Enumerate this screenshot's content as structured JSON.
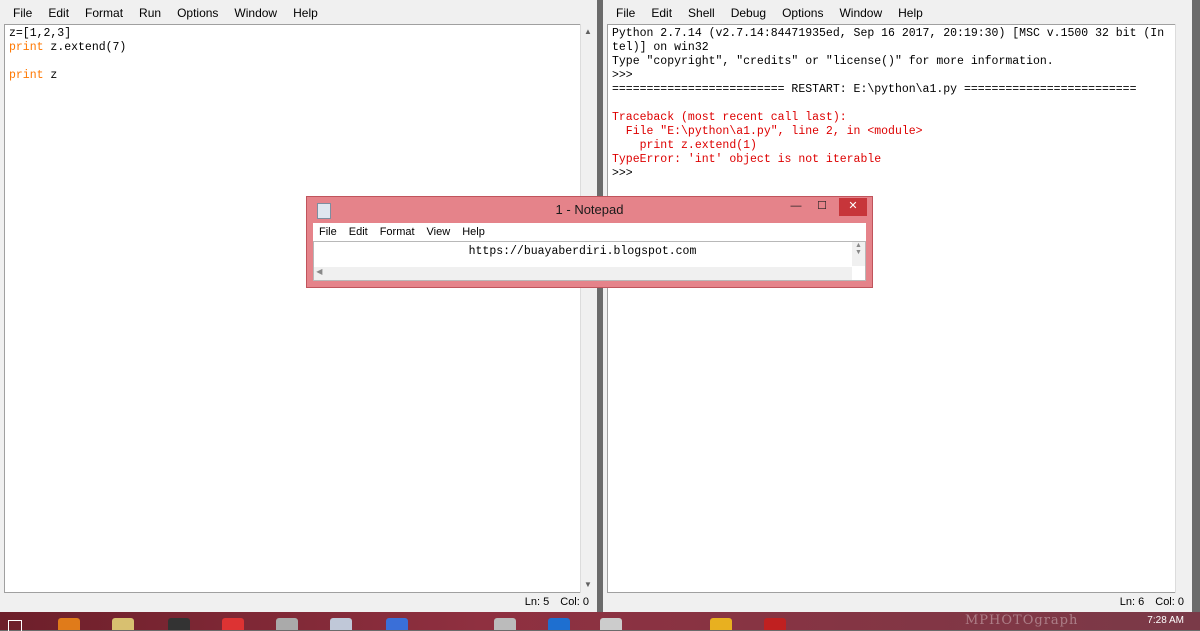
{
  "editor_window": {
    "menu": [
      "File",
      "Edit",
      "Format",
      "Run",
      "Options",
      "Window",
      "Help"
    ],
    "code": [
      [
        {
          "t": "z=[1,2,3]",
          "c": "plain"
        }
      ],
      [
        {
          "t": "print",
          "c": "kw"
        },
        {
          "t": " z.extend(7)",
          "c": "plain"
        }
      ],
      [
        {
          "t": "",
          "c": "plain"
        }
      ],
      [
        {
          "t": "print",
          "c": "kw"
        },
        {
          "t": " z",
          "c": "plain"
        }
      ]
    ],
    "status": {
      "ln": "Ln: 5",
      "col": "Col: 0"
    }
  },
  "shell_window": {
    "menu": [
      "File",
      "Edit",
      "Shell",
      "Debug",
      "Options",
      "Window",
      "Help"
    ],
    "lines": [
      {
        "t": "Python 2.7.14 (v2.7.14:84471935ed, Sep 16 2017, 20:19:30) [MSC v.1500 32 bit (In",
        "c": "plain"
      },
      {
        "t": "tel)] on win32",
        "c": "plain"
      },
      {
        "t": "Type \"copyright\", \"credits\" or \"license()\" for more information.",
        "c": "plain"
      },
      {
        "t": ">>> ",
        "c": "plain"
      },
      {
        "t": "========================= RESTART: E:\\python\\a1.py =========================",
        "c": "plain"
      },
      {
        "t": "",
        "c": "plain"
      },
      {
        "t": "Traceback (most recent call last):",
        "c": "red"
      },
      {
        "t": "  File \"E:\\python\\a1.py\", line 2, in <module>",
        "c": "red"
      },
      {
        "t": "    print z.extend(1)",
        "c": "red"
      },
      {
        "t": "TypeError: 'int' object is not iterable",
        "c": "red"
      },
      {
        "t": ">>> ",
        "c": "plain"
      }
    ],
    "status": {
      "ln": "Ln: 6",
      "col": "Col: 0"
    }
  },
  "notepad": {
    "title": "1 - Notepad",
    "menu": [
      "File",
      "Edit",
      "Format",
      "View",
      "Help"
    ],
    "content": "https://buayaberdiri.blogspot.com",
    "minimize_glyph": "—",
    "maximize_glyph": "☐",
    "close_glyph": "✕"
  },
  "taskbar": {
    "clock": "7:28 AM",
    "watermark": "MPHOTOgraph"
  },
  "colors": {
    "keyword": "#ff7700",
    "error": "#dd0000",
    "notepad_frame": "#e5838a"
  }
}
